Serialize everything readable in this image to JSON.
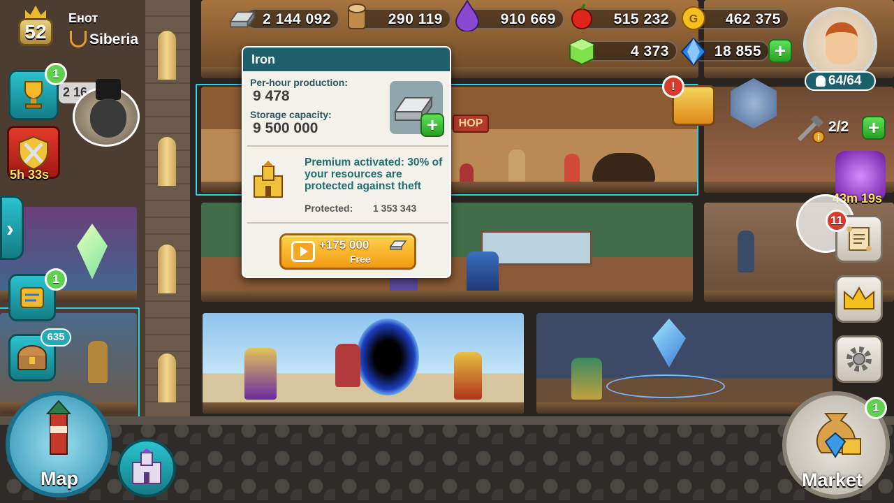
{
  "player": {
    "level": "52",
    "name": "Енот",
    "guild": "Siberia"
  },
  "resources": {
    "iron": "2 144 092",
    "wood": "290 119",
    "mana": "910 669",
    "food": "515 232",
    "gold": "462 375",
    "emerald": "4 373",
    "gems": "18 855"
  },
  "population": "64/64",
  "workers": "2/2",
  "colors": {
    "accent": "#1f5f6b",
    "selection": "#27d3e6",
    "badge_green": "#5fd14f",
    "badge_red": "#d93a2a"
  },
  "left_panel": {
    "trophy_badge": "1",
    "trophy_counter": "2 16",
    "event_timer": "5h 33s",
    "quest_badge": "1",
    "chest_badge": "635"
  },
  "right_panel": {
    "portal_timer": "43m 19s",
    "scroll_badge": "11"
  },
  "popup": {
    "title": "Iron",
    "production_label": "Per-hour production:",
    "production_value": "9 478",
    "storage_label": "Storage capacity:",
    "storage_value": "9 500 000",
    "premium_text": "Premium activated: 30% of your resources are protected against theft",
    "protected_label": "Protected:",
    "protected_value": "1 353 343",
    "button_amount": "+175 000",
    "button_label": "Free"
  },
  "room_sign": "HOP",
  "bottom": {
    "map_label": "Map",
    "market_label": "Market",
    "market_badge": "1"
  },
  "icons": [
    "iron-ingot-icon",
    "wood-log-icon",
    "mana-drop-icon",
    "apple-icon",
    "gold-coin-icon",
    "emerald-cube-icon",
    "diamond-icon",
    "trophy-icon",
    "shield-swords-icon",
    "chest-icon",
    "castle-icon",
    "crown-icon",
    "gear-icon",
    "scroll-icon",
    "hammer-wrench-icon",
    "tv-icon"
  ]
}
